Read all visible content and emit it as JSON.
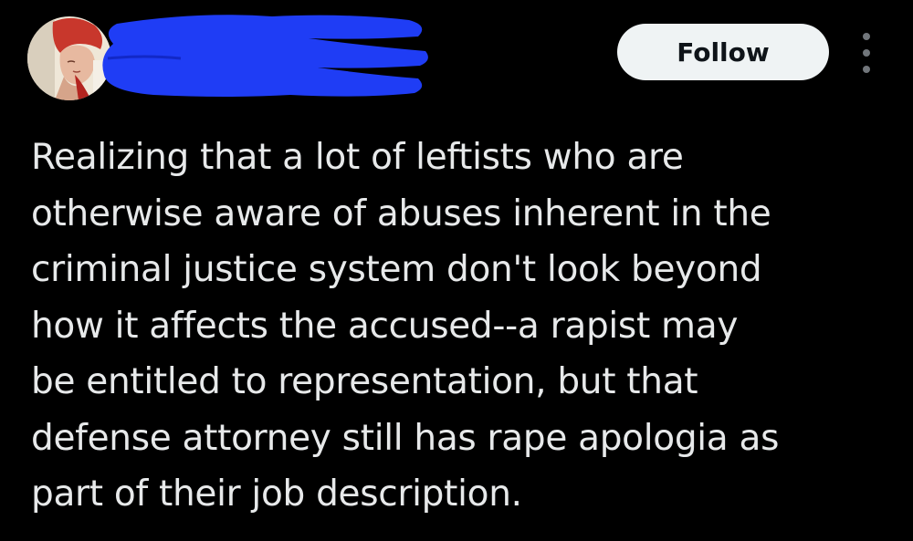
{
  "colors": {
    "background": "#000000",
    "text": "#e7e9ea",
    "follow_bg": "#eff3f4",
    "follow_text": "#0f1419",
    "redaction": "#1f3df5",
    "more_dots": "#71767b"
  },
  "header": {
    "avatar_icon": "profile-avatar",
    "name_redacted": true,
    "follow_label": "Follow",
    "more_icon": "more-vertical-icon"
  },
  "tweet": {
    "lines": [
      "Realizing that a lot of leftists who are",
      "otherwise aware of abuses inherent in the",
      "criminal justice system don't look beyond",
      "how it affects the accused--a rapist may",
      "be entitled to representation, but that",
      "defense attorney still has rape apologia as",
      "part of their job description."
    ]
  }
}
